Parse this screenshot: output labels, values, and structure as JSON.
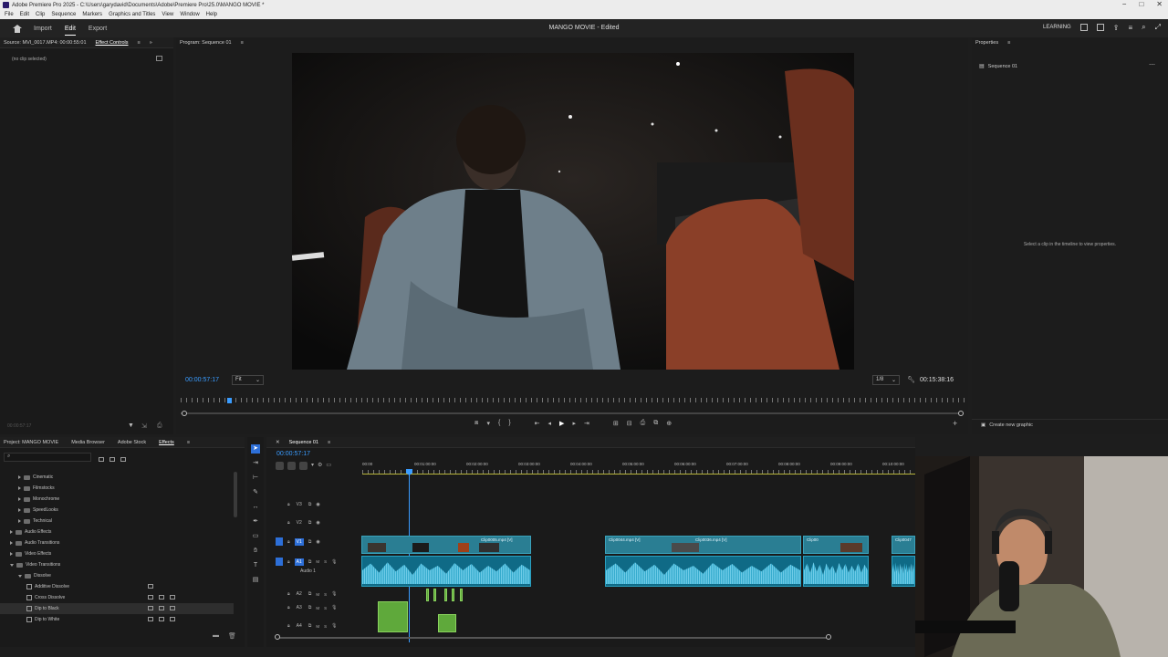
{
  "window": {
    "title": "Adobe Premiere Pro 2025 - C:\\Users\\garydavid\\Documents\\Adobe\\Premiere Pro\\25.0\\MANGO MOVIE *",
    "controls": [
      "−",
      "□",
      "✕"
    ]
  },
  "menu": [
    "File",
    "Edit",
    "Clip",
    "Sequence",
    "Markers",
    "Graphics and Titles",
    "View",
    "Window",
    "Help"
  ],
  "workspace": {
    "tabs": [
      "Import",
      "Edit",
      "Export"
    ],
    "active_tab": "Edit",
    "project_title": "MANGO MOVIE - Edited",
    "right_label": "LEARNING"
  },
  "source_panel": {
    "tab_source": "Source: MVI_0017.MP4: 00:00:55:01",
    "tab_active": "Effect Controls",
    "empty_text": "(no clip selected)",
    "bottom_timecode": "00:00:57:17"
  },
  "program": {
    "tab": "Program: Sequence 01",
    "timecode": "00:00:57:17",
    "fit": "Fit",
    "resolution": "1/8",
    "duration": "00:15:38:16",
    "playhead_fraction": 0.06
  },
  "properties": {
    "tab": "Properties",
    "item": "Sequence 01",
    "hint": "Select a clip in the timeline to view properties.",
    "create_graphic": "Create new graphic"
  },
  "project_panel": {
    "tabs": [
      "Project: MANGO MOVIE",
      "Media Browser",
      "Adobe Stock",
      "Effects"
    ],
    "active_tab": "Effects",
    "tree": [
      {
        "label": "Cinematic",
        "level": 2,
        "type": "folder"
      },
      {
        "label": "Filmstocks",
        "level": 2,
        "type": "folder"
      },
      {
        "label": "Monochrome",
        "level": 2,
        "type": "folder"
      },
      {
        "label": "SpeedLooks",
        "level": 2,
        "type": "folder"
      },
      {
        "label": "Technical",
        "level": 2,
        "type": "folder"
      },
      {
        "label": "Audio Effects",
        "level": 1,
        "type": "folder"
      },
      {
        "label": "Audio Transitions",
        "level": 1,
        "type": "folder"
      },
      {
        "label": "Video Effects",
        "level": 1,
        "type": "folder"
      },
      {
        "label": "Video Transitions",
        "level": 1,
        "type": "folder-open"
      },
      {
        "label": "Dissolve",
        "level": 2,
        "type": "folder-open"
      },
      {
        "label": "Additive Dissolve",
        "level": 3,
        "type": "effect"
      },
      {
        "label": "Cross Dissolve",
        "level": 3,
        "type": "effect"
      },
      {
        "label": "Dip to Black",
        "level": 3,
        "type": "effect",
        "selected": true
      },
      {
        "label": "Dip to White",
        "level": 3,
        "type": "effect"
      }
    ]
  },
  "timeline": {
    "tab": "Sequence 01",
    "timecode": "00:00:57:17",
    "ruler": [
      "00:00",
      "00:01:00:00",
      "00:02:00:00",
      "00:03:00:00",
      "00:04:00:00",
      "00:05:00:00",
      "00:06:00:00",
      "00:07:00:00",
      "00:08:00:00",
      "00:09:00:00",
      "00:10:00:00"
    ],
    "tracks": {
      "video": [
        "V3",
        "V2",
        "V1"
      ],
      "audio": [
        "A1",
        "A2",
        "A3",
        "A4"
      ],
      "audio1_name": "Audio 1"
    },
    "clips": [
      "Clip0005.mp4 [V]",
      "Clip0044.mp4 [V]",
      "Clip0036.mp4 [V]",
      "Clip00",
      "Clip0047"
    ]
  },
  "colors": {
    "accent": "#3a9cff",
    "video_clip": "#2a7e93",
    "audio_clip": "#0f6a86",
    "green_clip": "#5fa93b"
  }
}
